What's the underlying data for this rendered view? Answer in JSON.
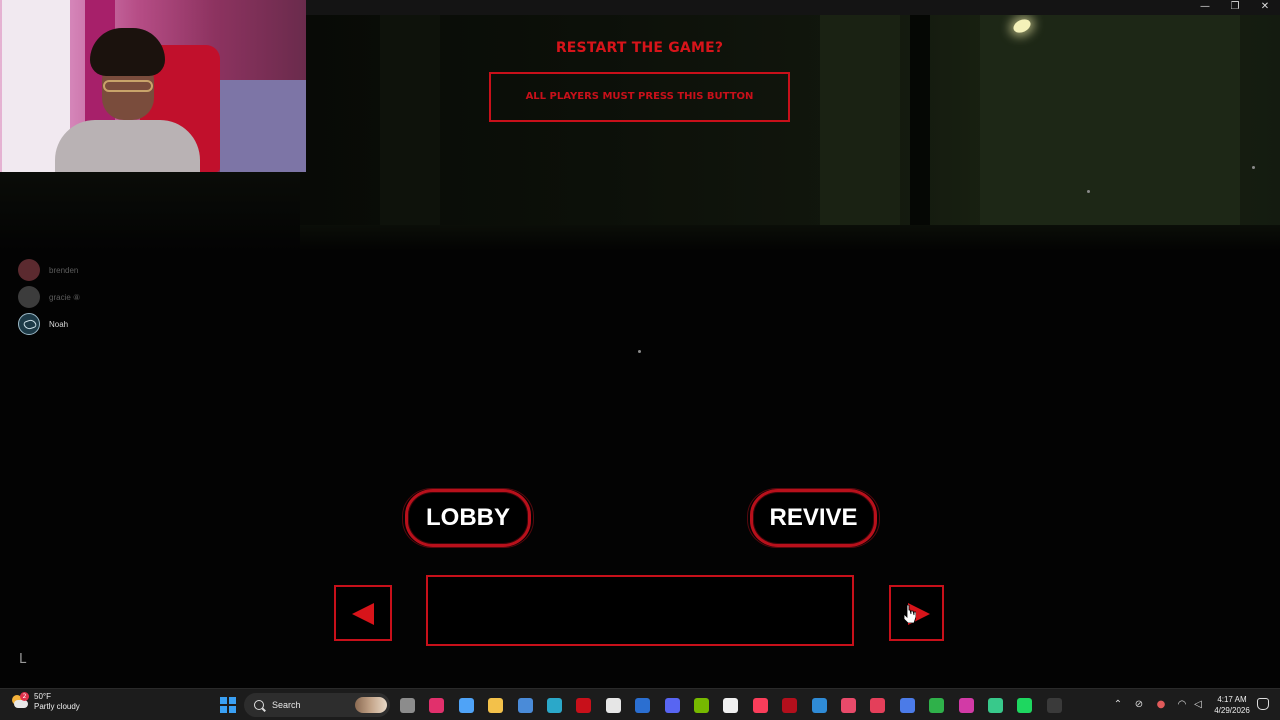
{
  "window": {
    "minimize_glyph": "—",
    "restore_glyph": "❐",
    "close_glyph": "✕"
  },
  "restart": {
    "title": "RESTART THE GAME?",
    "button_label": "ALL PLAYERS MUST PRESS THIS BUTTON"
  },
  "players": [
    {
      "name": "brenden",
      "state": "dim"
    },
    {
      "name": "gracie ⑧",
      "state": "dim"
    },
    {
      "name": "Noah",
      "state": "active"
    }
  ],
  "actions": {
    "lobby_label": "LOBBY",
    "revive_label": "REVIVE"
  },
  "spectate": {
    "prev_icon": "arrow-left-icon",
    "next_icon": "arrow-right-icon",
    "current_player": ""
  },
  "corner_glyph": "L",
  "taskbar": {
    "weather_badge": "2",
    "weather_temp": "50°F",
    "weather_desc": "Partly cloudy",
    "search_label": "Search",
    "clock_time": "4:17 AM",
    "clock_date": "4/29/2026",
    "apps": [
      {
        "name": "task-view-icon",
        "color": "#8c8c8c"
      },
      {
        "name": "instagram-icon",
        "color": "#e1306c"
      },
      {
        "name": "copilot-icon",
        "color": "#4fa3f7"
      },
      {
        "name": "file-explorer-icon",
        "color": "#f3c14a"
      },
      {
        "name": "microsoft-store-icon",
        "color": "#4a8bd8"
      },
      {
        "name": "edge-icon",
        "color": "#2ba8c9"
      },
      {
        "name": "mcafee-icon",
        "color": "#c8101a"
      },
      {
        "name": "dropbox-icon",
        "color": "#e6e6e6"
      },
      {
        "name": "word-icon",
        "color": "#2b6fd1"
      },
      {
        "name": "discord-icon",
        "color": "#5865f2"
      },
      {
        "name": "nvidia-icon",
        "color": "#76b900"
      },
      {
        "name": "tiktok-icon",
        "color": "#f0f0f0"
      },
      {
        "name": "apple-music-icon",
        "color": "#fa3d5a"
      },
      {
        "name": "red-app-icon",
        "color": "#b30f1c"
      },
      {
        "name": "blue-app-icon",
        "color": "#2f8bd6"
      },
      {
        "name": "tiktok-studio-icon",
        "color": "#e84a6a"
      },
      {
        "name": "streamlabs-icon",
        "color": "#e43f5a"
      },
      {
        "name": "roblox-icon",
        "color": "#4b7be8"
      },
      {
        "name": "xbox-icon",
        "color": "#2fb14a"
      },
      {
        "name": "pink-app-icon",
        "color": "#d23aa6"
      },
      {
        "name": "green-app-icon",
        "color": "#38c98b"
      },
      {
        "name": "spotify-icon",
        "color": "#1ed760"
      },
      {
        "name": "terminal-icon",
        "color": "#3a3a3a"
      }
    ]
  },
  "colors": {
    "accent_red": "#c8101a",
    "background": "#000000"
  }
}
